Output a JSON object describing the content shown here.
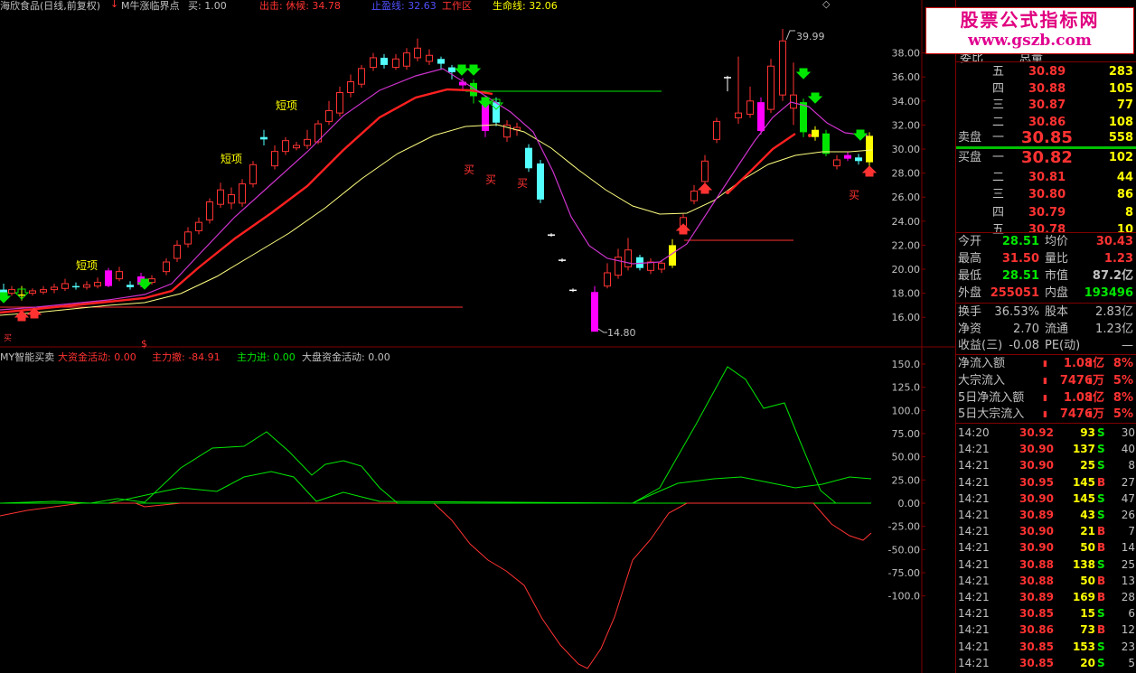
{
  "header": {
    "stock_title": "海欣食品(日线,前复权)",
    "indicator_name": "M牛涨临界点",
    "buy_label": "买: 1.00",
    "chuhuo_label": "出击: 休候: 34.78",
    "zhiying_label": "止盈线: 32.63",
    "gongzuo_label": "工作区",
    "shengming_label": "生命线: 32.06"
  },
  "sub_header": {
    "indicator": "MY智能买卖",
    "big_fund": "大资金活动: 0.00",
    "main_out": "主力撤: -84.91",
    "main_in": "主力进: 0.00",
    "market_fund": "大盘资金活动: 0.00"
  },
  "price_axis": [
    "38.00",
    "36.00",
    "34.00",
    "32.00",
    "30.00",
    "28.00",
    "26.00",
    "24.00",
    "22.00",
    "20.00",
    "18.00",
    "16.00"
  ],
  "osc_axis": [
    "150.0",
    "125.0",
    "100.0",
    "75.00",
    "50.00",
    "25.00",
    "0.00",
    "-25.00",
    "-50.00",
    "-75.00",
    "-100.0"
  ],
  "annotations": {
    "high": "39.99",
    "low": "14.80",
    "short_top": "短项",
    "buy": "买"
  },
  "watermark": {
    "line1": "股票公式指标网",
    "line2": "www.gszb.com"
  },
  "quote": {
    "row_hidden1": "委比",
    "row_hidden2": "总量",
    "sell_label": "卖盘",
    "buy_label": "买盘",
    "sells": [
      {
        "lv": "五",
        "price": "30.89",
        "vol": "283"
      },
      {
        "lv": "四",
        "price": "30.88",
        "vol": "105"
      },
      {
        "lv": "三",
        "price": "30.87",
        "vol": "77"
      },
      {
        "lv": "二",
        "price": "30.86",
        "vol": "108"
      },
      {
        "lv": "一",
        "price": "30.85",
        "vol": "558"
      }
    ],
    "buys": [
      {
        "lv": "一",
        "price": "30.82",
        "vol": "102"
      },
      {
        "lv": "二",
        "price": "30.81",
        "vol": "44"
      },
      {
        "lv": "三",
        "price": "30.80",
        "vol": "86"
      },
      {
        "lv": "四",
        "price": "30.79",
        "vol": "8"
      },
      {
        "lv": "五",
        "price": "30.78",
        "vol": "10"
      }
    ],
    "stats": [
      {
        "l1": "今开",
        "v1": "28.51",
        "l2": "均价",
        "v2": "30.43"
      },
      {
        "l1": "最高",
        "v1": "31.50",
        "l2": "量比",
        "v2": "1.23"
      },
      {
        "l1": "最低",
        "v1": "28.51",
        "l2": "市值",
        "v2": "87.2亿"
      },
      {
        "l1": "外盘",
        "v1": "255051",
        "l2": "内盘",
        "v2": "193496"
      }
    ],
    "stats2": [
      {
        "l1": "换手",
        "v1": "36.53%",
        "l2": "股本",
        "v2": "2.83亿"
      },
      {
        "l1": "净资",
        "v1": "2.70",
        "l2": "流通",
        "v2": "1.23亿"
      },
      {
        "l1": "收益(三)",
        "v1": "-0.08",
        "l2": "PE(动)",
        "v2": "—"
      }
    ],
    "flows": [
      {
        "l": "净流入额",
        "v": "1.08亿",
        "p": "8%"
      },
      {
        "l": "大宗流入",
        "v": "7476万",
        "p": "5%"
      },
      {
        "l": "5日净流入额",
        "v": "1.08亿",
        "p": "8%"
      },
      {
        "l": "5日大宗流入",
        "v": "7476万",
        "p": "5%"
      }
    ],
    "ticks": [
      {
        "t": "14:20",
        "p": "30.92",
        "v": "93",
        "s": "S",
        "n": "30"
      },
      {
        "t": "14:21",
        "p": "30.90",
        "v": "137",
        "s": "S",
        "n": "40"
      },
      {
        "t": "14:21",
        "p": "30.90",
        "v": "25",
        "s": "S",
        "n": "8"
      },
      {
        "t": "14:21",
        "p": "30.95",
        "v": "145",
        "s": "B",
        "n": "27"
      },
      {
        "t": "14:21",
        "p": "30.90",
        "v": "145",
        "s": "S",
        "n": "47"
      },
      {
        "t": "14:21",
        "p": "30.89",
        "v": "43",
        "s": "S",
        "n": "26"
      },
      {
        "t": "14:21",
        "p": "30.90",
        "v": "21",
        "s": "B",
        "n": "7"
      },
      {
        "t": "14:21",
        "p": "30.90",
        "v": "50",
        "s": "B",
        "n": "14"
      },
      {
        "t": "14:21",
        "p": "30.88",
        "v": "138",
        "s": "S",
        "n": "25"
      },
      {
        "t": "14:21",
        "p": "30.88",
        "v": "50",
        "s": "B",
        "n": "13"
      },
      {
        "t": "14:21",
        "p": "30.89",
        "v": "169",
        "s": "B",
        "n": "28"
      },
      {
        "t": "14:21",
        "p": "30.85",
        "v": "15",
        "s": "S",
        "n": "6"
      },
      {
        "t": "14:21",
        "p": "30.86",
        "v": "73",
        "s": "B",
        "n": "12"
      },
      {
        "t": "14:21",
        "p": "30.85",
        "v": "153",
        "s": "S",
        "n": "23"
      },
      {
        "t": "14:21",
        "p": "30.85",
        "v": "20",
        "s": "S",
        "n": "5"
      }
    ]
  },
  "colors": {
    "up": "#ff3232",
    "down": "#00e600",
    "cyan": "#54ffff",
    "magenta": "#ff00ff",
    "yellow": "#ffff00"
  }
}
